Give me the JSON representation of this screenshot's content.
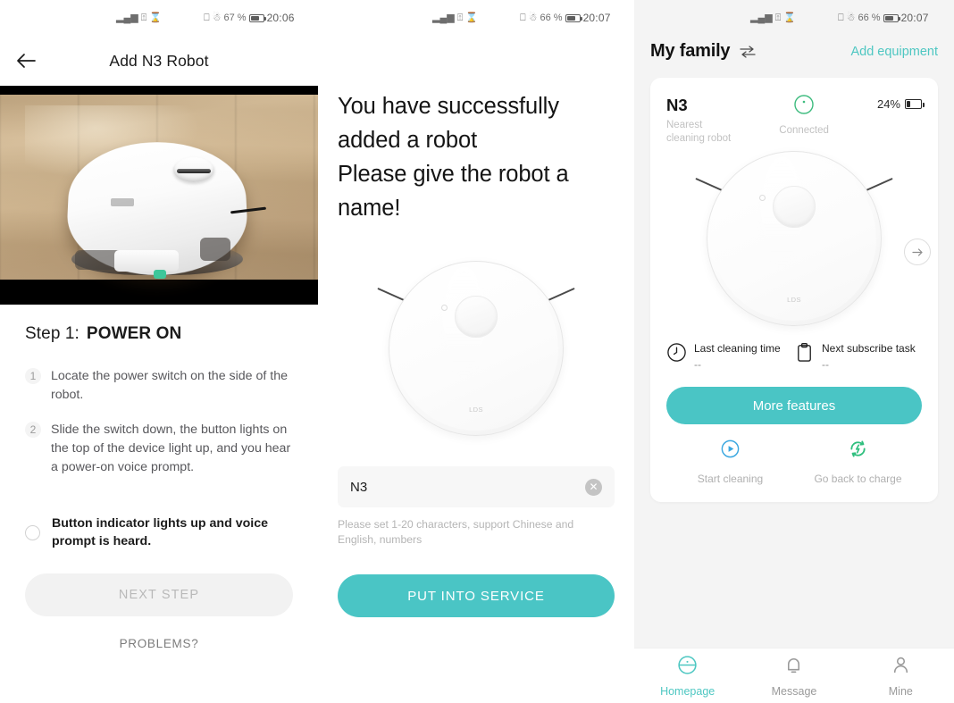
{
  "panel_a": {
    "status": {
      "time": "20:06",
      "battery_pct": "67 %",
      "icons": [
        "signal-icon",
        "wifi-icon",
        "hourglass-icon",
        "nfc-icon",
        "bluetooth-icon"
      ]
    },
    "appbar": {
      "back_icon": "back-arrow-icon",
      "title": "Add N3 Robot"
    },
    "media": {
      "alt": "robot-vacuum-on-wood-floor-photo"
    },
    "step": {
      "label": "Step 1:",
      "value": "POWER ON"
    },
    "instructions": [
      {
        "num": "1",
        "text": "Locate the power switch on the side of the robot."
      },
      {
        "num": "2",
        "text": "Slide the switch down, the button lights on the top of the device light up, and you hear a power-on voice prompt."
      }
    ],
    "confirm": {
      "text": "Button indicator lights up and voice prompt is heard.",
      "checked": false
    },
    "next_button": "NEXT STEP",
    "problems_link": "PROBLEMS?"
  },
  "panel_b": {
    "status": {
      "time": "20:07",
      "battery_pct": "66 %"
    },
    "heading": "You have successfully added a robot\nPlease give the robot a name!",
    "heading_lines": [
      "You have successfully",
      "added a robot",
      "Please give the robot a",
      "name!"
    ],
    "robot": {
      "brand": "LDS",
      "alt": "robot-vacuum-top-view-illustration"
    },
    "name_input": {
      "value": "N3",
      "placeholder": "",
      "clear_icon": "clear-circle-icon"
    },
    "hint": "Please set 1-20 characters, support Chinese and English, numbers",
    "cta": "PUT INTO SERVICE"
  },
  "panel_c": {
    "status": {
      "time": "20:07",
      "battery_pct": "66 %"
    },
    "header": {
      "title": "My family",
      "swap_icon": "swap-arrows-icon",
      "add_link": "Add equipment"
    },
    "device": {
      "name": "N3",
      "subtitle_line1": "Nearest",
      "subtitle_line2": "cleaning robot",
      "status_text": "Connected",
      "status_icon": "connected-circle-icon",
      "battery_pct": "24%",
      "battery_level": 24,
      "next_arrow_icon": "arrow-right-circle-icon",
      "robot_alt": "robot-vacuum-top-view-illustration"
    },
    "stats": [
      {
        "icon": "clock-icon",
        "label": "Last cleaning time",
        "value": "--"
      },
      {
        "icon": "clipboard-icon",
        "label": "Next subscribe task",
        "value": "--"
      }
    ],
    "more_button": "More features",
    "actions": [
      {
        "icon": "play-circle-icon",
        "label": "Start cleaning",
        "color": "#3aa7e0"
      },
      {
        "icon": "recharge-icon",
        "label": "Go back to charge",
        "color": "#2fbf7e"
      }
    ],
    "nav": [
      {
        "icon": "homepage-icon",
        "label": "Homepage",
        "active": true
      },
      {
        "icon": "bell-icon",
        "label": "Message",
        "active": false
      },
      {
        "icon": "person-icon",
        "label": "Mine",
        "active": false
      }
    ]
  },
  "colors": {
    "teal": "#4ac5c5",
    "link_teal": "#4ec7c2",
    "green": "#3dbb7e",
    "panel_bg": "#f4f4f4"
  }
}
